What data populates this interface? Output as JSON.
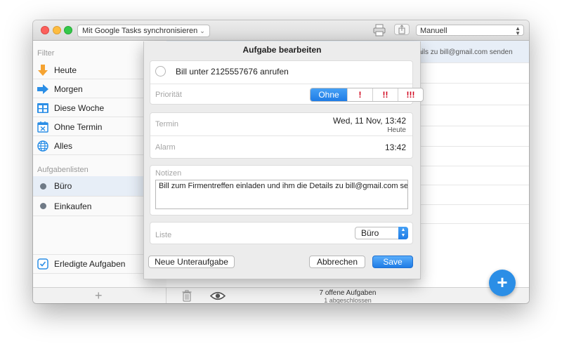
{
  "toolbar": {
    "sync_label": "Mit Google Tasks synchronisieren",
    "sort_value": "Manuell"
  },
  "sidebar": {
    "filter_header": "Filter",
    "filters": [
      {
        "label": "Heute",
        "icon": "arrow-down-icon"
      },
      {
        "label": "Morgen",
        "icon": "arrow-right-icon"
      },
      {
        "label": "Diese Woche",
        "icon": "week-calendar-icon"
      },
      {
        "label": "Ohne Termin",
        "icon": "no-date-calendar-icon"
      },
      {
        "label": "Alles",
        "icon": "globe-icon"
      }
    ],
    "lists_header": "Aufgabenlisten",
    "lists": [
      {
        "label": "Büro",
        "selected": true
      },
      {
        "label": "Einkaufen",
        "selected": false
      }
    ],
    "completed_label": "Erledigte Aufgaben"
  },
  "main": {
    "peek_text": "ails zu bill@gmail.com senden",
    "open_count": "7 offene Aufgaben",
    "done_count": "1 abgeschlossen"
  },
  "dialog": {
    "title": "Aufgabe bearbeiten",
    "task_title": "Bill unter 2125557676 anrufen",
    "priority_label": "Priorität",
    "priority_options": [
      "Ohne",
      "!",
      "!!",
      "!!!"
    ],
    "priority_selected": "Ohne",
    "due_label": "Termin",
    "due_value": "Wed, 11 Nov, 13:42",
    "due_sub": "Heute",
    "alarm_label": "Alarm",
    "alarm_value": "13:42",
    "notes_label": "Notizen",
    "notes_value": "Bill zum Firmentreffen einladen und ihm die Details zu bill@gmail.com senden",
    "list_label": "Liste",
    "list_value": "Büro",
    "btn_subtask": "Neue Unteraufgabe",
    "btn_cancel": "Abbrechen",
    "btn_save": "Save"
  },
  "colors": {
    "accent": "#1f7ce6",
    "priority_mark": "#d0021b",
    "fab": "#2b8ee6"
  }
}
